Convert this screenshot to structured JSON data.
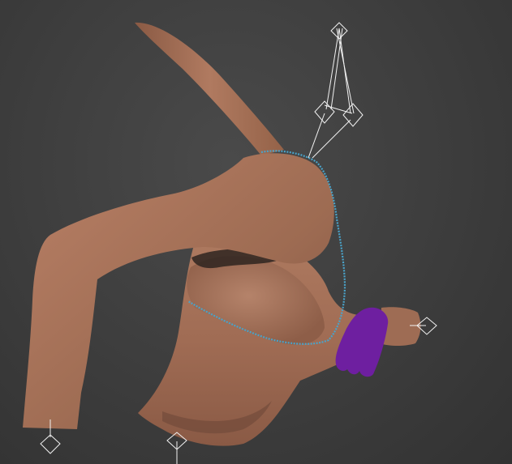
{
  "viewport": {
    "background_color": "#3d3d3d",
    "skin_color": "#a5735a",
    "skin_shadow_color": "#6b4434",
    "selection_spline_color": "#4aa3c9",
    "hand_color": "#6e1fa0",
    "helper_color": "#f2f2f2"
  },
  "scene_objects": [
    {
      "name": "torso-with-raised-arm-mesh",
      "icon": "skin-mesh"
    },
    {
      "name": "selected-edge-loop",
      "icon": "blue-dotted-spline"
    },
    {
      "name": "purple-hand-object",
      "icon": "hand-shape"
    },
    {
      "name": "ik-helper-wireframes",
      "icon": "diamond-point-helper"
    }
  ]
}
